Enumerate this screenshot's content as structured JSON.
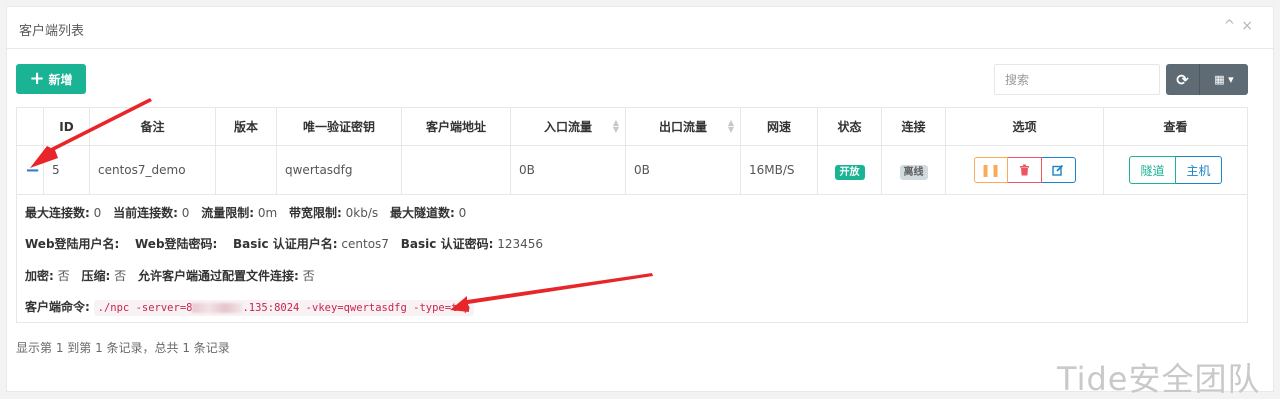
{
  "panel": {
    "title": "客户端列表",
    "tools": {
      "collapse": "^",
      "close": "×"
    }
  },
  "toolbar": {
    "add_label": "新增",
    "search_placeholder": "搜索",
    "refresh_icon": "refresh-icon",
    "columns_icon": "columns-icon"
  },
  "table": {
    "headers": [
      "",
      "ID",
      "备注",
      "版本",
      "唯一验证密钥",
      "客户端地址",
      "入口流量",
      "出口流量",
      "网速",
      "状态",
      "连接",
      "选项",
      "查看"
    ],
    "row": {
      "expand": "−",
      "id": "5",
      "remark": "centos7_demo",
      "version": "",
      "vkey": "qwertasdfg",
      "address": "",
      "inlet_flow": "0B",
      "export_flow": "0B",
      "speed": "16MB/S",
      "status": "开放",
      "connect": "离线",
      "view_tunnel": "隧道",
      "view_host": "主机"
    },
    "detail": {
      "line1": [
        {
          "label": "最大连接数:",
          "value": "0"
        },
        {
          "label": "当前连接数:",
          "value": "0"
        },
        {
          "label": "流量限制:",
          "value": "0m"
        },
        {
          "label": "带宽限制:",
          "value": "0kb/s"
        },
        {
          "label": "最大隧道数:",
          "value": "0"
        }
      ],
      "line2": [
        {
          "label": "Web登陆用户名:",
          "value": ""
        },
        {
          "label": "Web登陆密码:",
          "value": ""
        },
        {
          "label": "Basic 认证用户名:",
          "value": "centos7"
        },
        {
          "label": "Basic 认证密码:",
          "value": "123456"
        }
      ],
      "line3": [
        {
          "label": "加密:",
          "value": "否"
        },
        {
          "label": "压缩:",
          "value": "否"
        },
        {
          "label": "允许客户端通过配置文件连接:",
          "value": "否"
        }
      ],
      "cmd_label": "客户端命令:",
      "cmd_prefix": "./npc -server=8",
      "cmd_suffix": ".135:8024 -vkey=qwertasdfg -type=tcp"
    }
  },
  "footer": {
    "summary": "显示第 1 到第 1 条记录，总共 1 条记录"
  },
  "watermark": "Tide安全团队",
  "colors": {
    "primary": "#1ab394",
    "danger": "#ed5565",
    "warning": "#f8ac59",
    "info": "#1c84c6",
    "annotation_arrow": "#e8262a"
  }
}
